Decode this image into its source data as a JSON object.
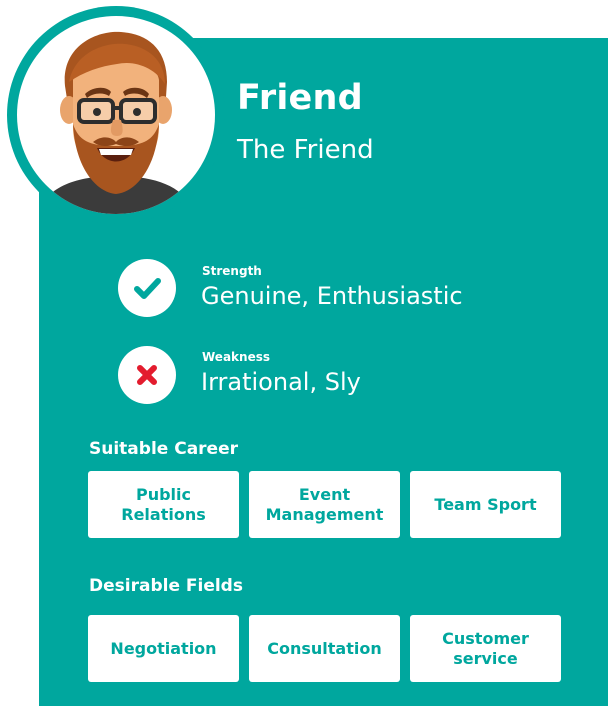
{
  "profile": {
    "name": "Friend",
    "subtitle": "The Friend"
  },
  "traits": {
    "strength_label": "Strength",
    "strength_value": "Genuine, Enthusiastic",
    "weakness_label": "Weakness",
    "weakness_value": "Irrational, Sly"
  },
  "careers": {
    "heading": "Suitable Career",
    "items": [
      "Public Relations",
      "Event Management",
      "Team Sport"
    ]
  },
  "fields": {
    "heading": "Desirable Fields",
    "items": [
      "Negotiation",
      "Consultation",
      "Customer service"
    ]
  },
  "icons": {
    "strength": "check-icon",
    "weakness": "cross-icon",
    "avatar": "bearded-man-avatar"
  },
  "colors": {
    "teal": "#00a79e",
    "cross_red": "#e31c2e",
    "background": "#ffffff"
  }
}
